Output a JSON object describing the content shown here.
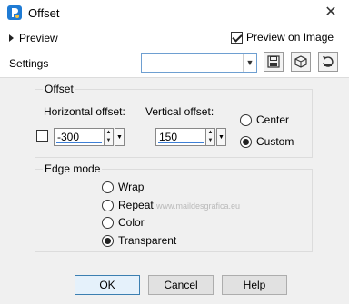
{
  "window": {
    "title": "Offset",
    "close_glyph": "✕"
  },
  "preview": {
    "toggle_label": "Preview",
    "preview_on_image_label": "Preview on Image",
    "preview_on_image_checked": true
  },
  "settings": {
    "label": "Settings",
    "value": ""
  },
  "offset": {
    "group_label": "Offset",
    "horizontal_label": "Horizontal offset:",
    "horizontal_value": "-300",
    "vertical_label": "Vertical offset:",
    "vertical_value": "150",
    "center_label": "Center",
    "custom_label": "Custom",
    "selected": "Custom"
  },
  "edge_mode": {
    "group_label": "Edge mode",
    "options": [
      "Wrap",
      "Repeat",
      "Color",
      "Transparent"
    ],
    "selected": "Transparent"
  },
  "buttons": {
    "ok": "OK",
    "cancel": "Cancel",
    "help": "Help"
  },
  "watermark": "www.maildesgrafica.eu",
  "icons": [
    "app-icon",
    "save-icon",
    "cube-icon",
    "reset-icon"
  ]
}
